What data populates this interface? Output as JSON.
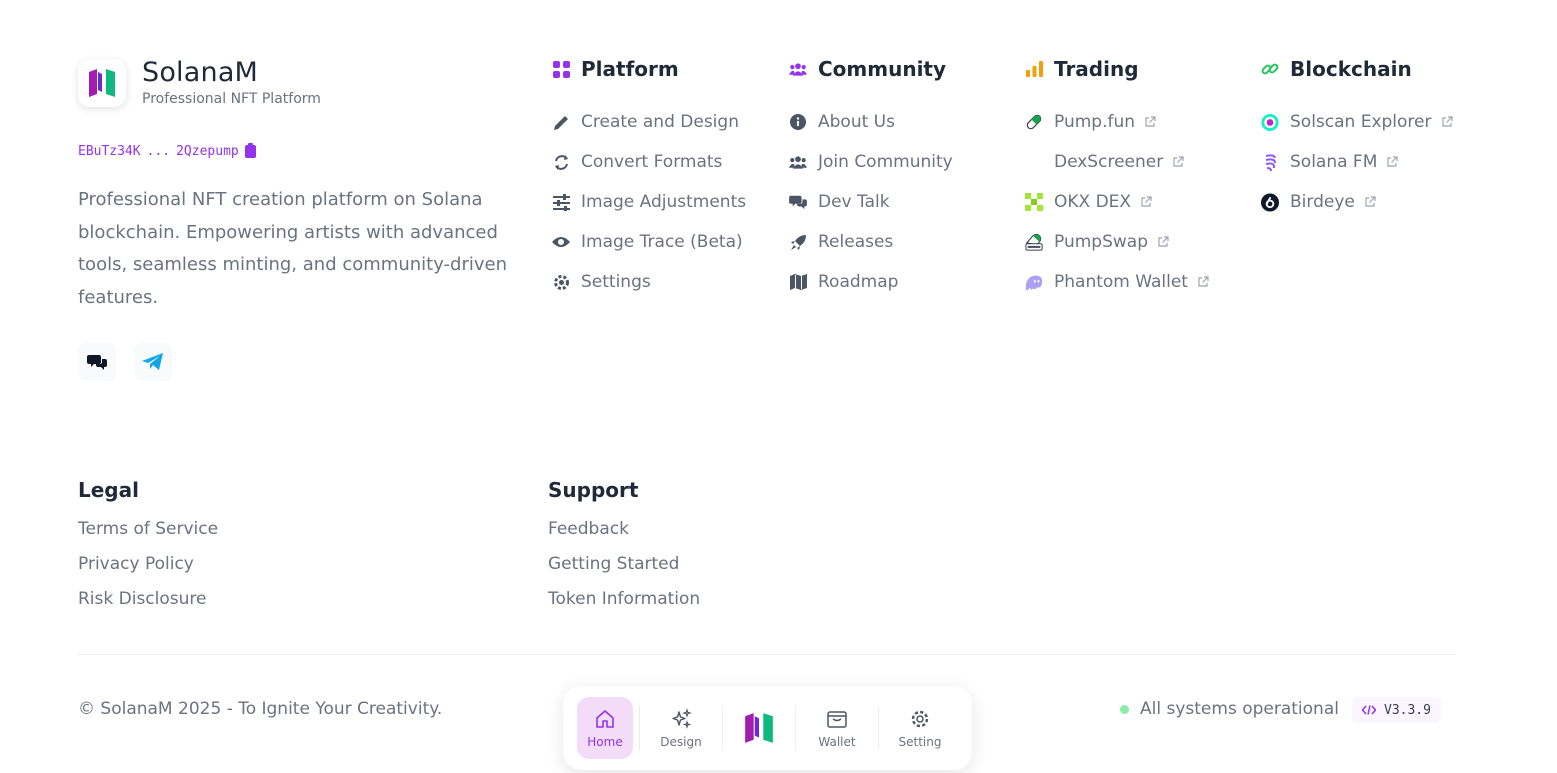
{
  "brand": {
    "name": "SolanaM",
    "tagline": "Professional NFT Platform",
    "address_start": "EBuTz34K",
    "address_sep": "...",
    "address_end": "2Qzepump",
    "description": "Professional NFT creation platform on Solana blockchain. Empowering artists with advanced tools, seamless minting, and community-driven features."
  },
  "columns": {
    "platform": {
      "title": "Platform",
      "items": [
        "Create and Design",
        "Convert Formats",
        "Image Adjustments",
        "Image Trace (Beta)",
        "Settings"
      ]
    },
    "community": {
      "title": "Community",
      "items": [
        "About Us",
        "Join Community",
        "Dev Talk",
        "Releases",
        "Roadmap"
      ]
    },
    "trading": {
      "title": "Trading",
      "items": [
        "Pump.fun",
        "DexScreener",
        "OKX DEX",
        "PumpSwap",
        "Phantom Wallet"
      ]
    },
    "blockchain": {
      "title": "Blockchain",
      "items": [
        "Solscan Explorer",
        "Solana FM",
        "Birdeye"
      ]
    }
  },
  "legal": {
    "title": "Legal",
    "items": [
      "Terms of Service",
      "Privacy Policy",
      "Risk Disclosure"
    ]
  },
  "support": {
    "title": "Support",
    "items": [
      "Feedback",
      "Getting Started",
      "Token Information"
    ]
  },
  "footer": {
    "copyright": "© SolanaM 2025 - To Ignite Your Creativity.",
    "status": "All systems operational",
    "version": "V3.3.9"
  },
  "dock": {
    "home": "Home",
    "design": "Design",
    "wallet": "Wallet",
    "setting": "Setting"
  },
  "colors": {
    "accent": "#9333ea",
    "logo_purple": "#a21caf",
    "logo_green": "#10b981",
    "status_green": "#86efac",
    "trading_orange": "#f59e0b",
    "blockchain_green": "#22c55e"
  }
}
